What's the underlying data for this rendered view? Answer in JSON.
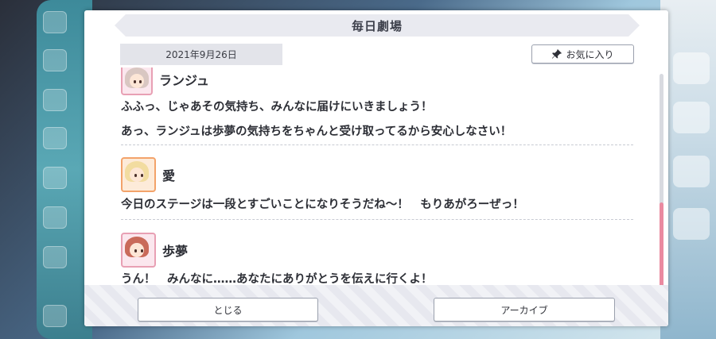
{
  "dialog": {
    "title": "毎日劇場",
    "date": "2021年9月26日",
    "favorite_label": "お気に入り",
    "close_label": "とじる",
    "archive_label": "アーカイブ"
  },
  "messages": [
    {
      "speaker": "ランジュ",
      "lines": [
        "ふふっ、じゃあその気持ち、みんなに届けにいきましょう！",
        "あっ、ランジュは歩夢の気持ちをちゃんと受け取ってるから安心しなさい！"
      ]
    },
    {
      "speaker": "愛",
      "lines": [
        "今日のステージは一段とすごいことになりそうだね～！　もりあがろーぜっ！"
      ]
    },
    {
      "speaker": "歩夢",
      "lines": [
        "うん！　みんなに……あなたにありがとうを伝えに行くよ！"
      ]
    }
  ],
  "colors": {
    "accent_pink": "#ea8aa0",
    "text": "#2d2f36"
  }
}
